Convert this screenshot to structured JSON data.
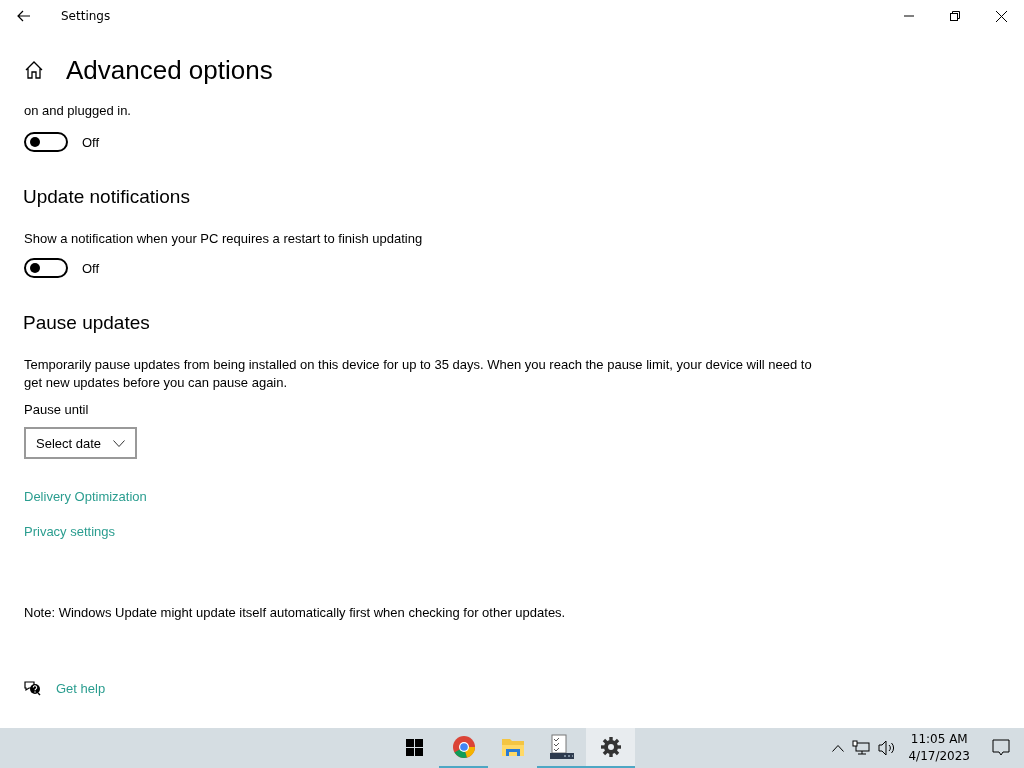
{
  "window": {
    "title": "Settings"
  },
  "page": {
    "title": "Advanced options"
  },
  "sections": [
    {
      "description": "on and plugged in.",
      "toggle": {
        "on": false,
        "label": "Off"
      }
    },
    {
      "heading": "Update notifications",
      "description": "Show a notification when your PC requires a restart to finish updating",
      "toggle": {
        "on": false,
        "label": "Off"
      }
    },
    {
      "heading": "Pause updates",
      "description": "Temporarily pause updates from being installed on this device for up to 35 days. When you reach the pause limit, your device will need to get new updates before you can pause again.",
      "field_label": "Pause until",
      "dropdown": {
        "value": "Select date"
      }
    }
  ],
  "links": [
    "Delivery Optimization",
    "Privacy settings"
  ],
  "note": "Note: Windows Update might update itself automatically first when checking for other updates.",
  "help_link": "Get help",
  "taskbar": {
    "apps": [
      {
        "kind": "start",
        "running": false,
        "selected": false
      },
      {
        "kind": "browser",
        "running": true,
        "selected": false
      },
      {
        "kind": "folder",
        "running": false,
        "selected": false
      },
      {
        "kind": "checklist",
        "running": true,
        "selected": false
      },
      {
        "kind": "settings",
        "running": true,
        "selected": true
      }
    ],
    "time": "11:05 AM",
    "date": "4/17/2023"
  }
}
